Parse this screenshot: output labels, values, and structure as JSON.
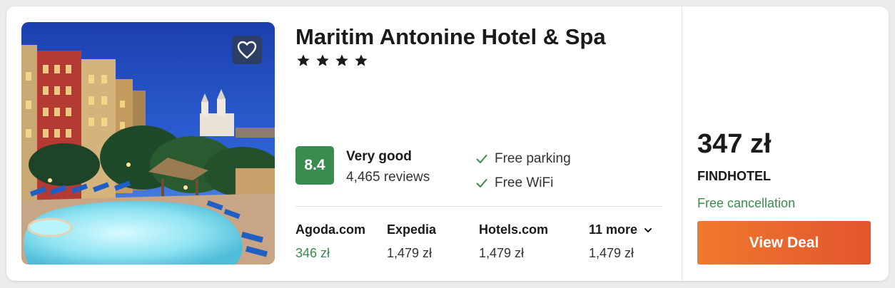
{
  "hotel": {
    "name": "Maritim Antonine Hotel & Spa",
    "star_count": 4,
    "stars_text": "★ ★ ★ ★"
  },
  "image": {
    "icon": "hotel-photo",
    "alt": "Hotel exterior with pool at dusk"
  },
  "favorite": {
    "icon": "heart-icon"
  },
  "rating": {
    "score": "8.4",
    "label": "Very good",
    "reviews": "4,465 reviews",
    "badge_color": "#3a8b50"
  },
  "amenities": [
    {
      "label": "Free parking",
      "icon": "check-icon"
    },
    {
      "label": "Free WiFi",
      "icon": "check-icon"
    }
  ],
  "providers": [
    {
      "name": "Agoda.com",
      "price": "346 zł",
      "best": true
    },
    {
      "name": "Expedia",
      "price": "1,479 zł",
      "best": false
    },
    {
      "name": "Hotels.com",
      "price": "1,479 zł",
      "best": false
    }
  ],
  "more": {
    "label": "11 more",
    "price": "1,479 zł",
    "icon": "chevron-down-icon"
  },
  "deal": {
    "price": "347 zł",
    "seller": "FINDHOTEL",
    "cancellation": "Free cancellation",
    "button_label": "View Deal",
    "button_color": "#ef7a2d",
    "accent_green": "#3a8b50"
  }
}
